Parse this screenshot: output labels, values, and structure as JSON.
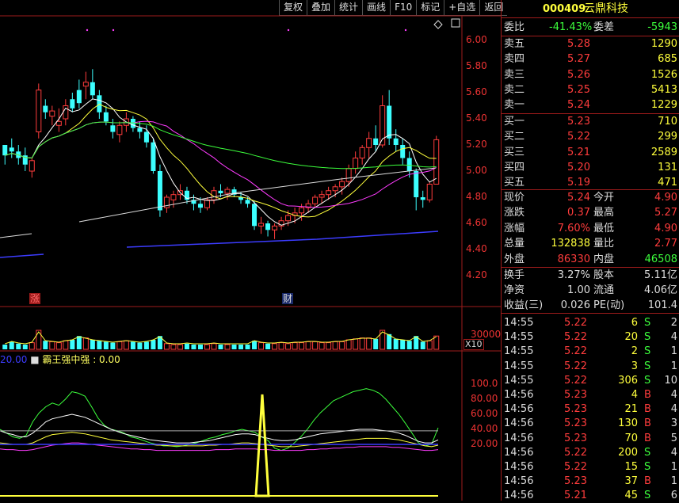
{
  "toolbar": {
    "items": [
      "复权",
      "叠加",
      "统计",
      "画线",
      "F10",
      "标记",
      "+自选",
      "返回"
    ]
  },
  "stock": {
    "code": "000409",
    "name": "云鼎科技"
  },
  "weibi": {
    "label1": "委比",
    "value1": "-41.43%",
    "label2": "委差",
    "value2": "-5943"
  },
  "asks": [
    {
      "label": "卖五",
      "price": "5.28",
      "vol": "1290"
    },
    {
      "label": "卖四",
      "price": "5.27",
      "vol": "685"
    },
    {
      "label": "卖三",
      "price": "5.26",
      "vol": "1526"
    },
    {
      "label": "卖二",
      "price": "5.25",
      "vol": "5413"
    },
    {
      "label": "卖一",
      "price": "5.24",
      "vol": "1229"
    }
  ],
  "bids": [
    {
      "label": "买一",
      "price": "5.23",
      "vol": "710"
    },
    {
      "label": "买二",
      "price": "5.22",
      "vol": "299"
    },
    {
      "label": "买三",
      "price": "5.21",
      "vol": "2589"
    },
    {
      "label": "买四",
      "price": "5.20",
      "vol": "131"
    },
    {
      "label": "买五",
      "price": "5.19",
      "vol": "471"
    }
  ],
  "quote": [
    {
      "l1": "现价",
      "v1": "5.24",
      "l2": "今开",
      "v2": "4.90",
      "c1": "red",
      "c2": "red"
    },
    {
      "l1": "涨跌",
      "v1": "0.37",
      "l2": "最高",
      "v2": "5.27",
      "c1": "red",
      "c2": "red"
    },
    {
      "l1": "涨幅",
      "v1": "7.60%",
      "l2": "最低",
      "v2": "4.90",
      "c1": "red",
      "c2": "red"
    },
    {
      "l1": "总量",
      "v1": "132838",
      "l2": "量比",
      "v2": "2.77",
      "c1": "yel",
      "c2": "red"
    },
    {
      "l1": "外盘",
      "v1": "86330",
      "l2": "内盘",
      "v2": "46508",
      "c1": "red",
      "c2": "grn"
    }
  ],
  "info": [
    {
      "l1": "换手",
      "v1": "3.27%",
      "l2": "股本",
      "v2": "5.11亿"
    },
    {
      "l1": "净资",
      "v1": "1.00",
      "l2": "流通",
      "v2": "4.06亿"
    },
    {
      "l1": "收益(三)",
      "v1": "0.026",
      "l2": "PE(动)",
      "v2": "101.4"
    }
  ],
  "ticks": [
    {
      "time": "14:55",
      "price": "5.22",
      "vol": "6",
      "bs": "S",
      "n": "2"
    },
    {
      "time": "14:55",
      "price": "5.22",
      "vol": "20",
      "bs": "S",
      "n": "4"
    },
    {
      "time": "14:55",
      "price": "5.22",
      "vol": "2",
      "bs": "S",
      "n": "1"
    },
    {
      "time": "14:55",
      "price": "5.22",
      "vol": "3",
      "bs": "S",
      "n": "1"
    },
    {
      "time": "14:55",
      "price": "5.22",
      "vol": "306",
      "bs": "S",
      "n": "10"
    },
    {
      "time": "14:56",
      "price": "5.23",
      "vol": "4",
      "bs": "B",
      "n": "4"
    },
    {
      "time": "14:56",
      "price": "5.23",
      "vol": "21",
      "bs": "B",
      "n": "4"
    },
    {
      "time": "14:56",
      "price": "5.23",
      "vol": "130",
      "bs": "B",
      "n": "3"
    },
    {
      "time": "14:56",
      "price": "5.23",
      "vol": "70",
      "bs": "B",
      "n": "5"
    },
    {
      "time": "14:56",
      "price": "5.22",
      "vol": "200",
      "bs": "S",
      "n": "4"
    },
    {
      "time": "14:56",
      "price": "5.22",
      "vol": "15",
      "bs": "S",
      "n": "1"
    },
    {
      "time": "14:56",
      "price": "5.23",
      "vol": "37",
      "bs": "B",
      "n": "1"
    },
    {
      "time": "14:56",
      "price": "5.21",
      "vol": "45",
      "bs": "S",
      "n": "6"
    }
  ],
  "price_axis": [
    "6.00",
    "5.80",
    "5.60",
    "5.40",
    "5.20",
    "5.00",
    "4.80",
    "4.60",
    "4.40",
    "4.20"
  ],
  "vol_axis": {
    "top": "30000",
    "unit": "X10"
  },
  "ind_axis": [
    "100.0",
    "80.00",
    "60.00",
    "40.00",
    "20.00"
  ],
  "markers": {
    "zhang": "涨",
    "cai": "财"
  },
  "indicator": {
    "prefix": "20.00",
    "name": "霸王强中强",
    "value": "0.00"
  },
  "colors": {
    "up": "#ff3c3c",
    "down": "#3cffff",
    "axis": "#9e1b1b"
  },
  "candles": [
    [
      5.2,
      5.2,
      5.05,
      5.12
    ],
    [
      5.18,
      5.25,
      5.1,
      5.15
    ],
    [
      5.15,
      5.2,
      5.05,
      5.1
    ],
    [
      5.12,
      5.18,
      5.0,
      5.05
    ],
    [
      5.0,
      5.1,
      4.95,
      5.08
    ],
    [
      5.3,
      5.67,
      5.25,
      5.62
    ],
    [
      5.5,
      5.55,
      5.4,
      5.45
    ],
    [
      5.42,
      5.5,
      5.35,
      5.46
    ],
    [
      5.35,
      5.48,
      5.3,
      5.38
    ],
    [
      5.4,
      5.55,
      5.35,
      5.5
    ],
    [
      5.55,
      5.6,
      5.45,
      5.48
    ],
    [
      5.62,
      5.7,
      5.48,
      5.52
    ],
    [
      5.65,
      5.76,
      5.55,
      5.68
    ],
    [
      5.68,
      5.78,
      5.55,
      5.58
    ],
    [
      5.58,
      5.62,
      5.4,
      5.45
    ],
    [
      5.45,
      5.5,
      5.35,
      5.38
    ],
    [
      5.35,
      5.4,
      5.25,
      5.3
    ],
    [
      5.28,
      5.38,
      5.22,
      5.35
    ],
    [
      5.35,
      5.45,
      5.3,
      5.4
    ],
    [
      5.4,
      5.42,
      5.3,
      5.33
    ],
    [
      5.33,
      5.38,
      5.25,
      5.3
    ],
    [
      5.3,
      5.35,
      5.18,
      5.22
    ],
    [
      5.22,
      5.25,
      4.98,
      5.0
    ],
    [
      5.0,
      5.05,
      4.65,
      4.7
    ],
    [
      4.72,
      4.82,
      4.68,
      4.8
    ],
    [
      4.78,
      4.85,
      4.72,
      4.82
    ],
    [
      4.82,
      4.9,
      4.78,
      4.85
    ],
    [
      4.85,
      4.88,
      4.75,
      4.78
    ],
    [
      4.78,
      4.82,
      4.7,
      4.75
    ],
    [
      4.75,
      4.8,
      4.68,
      4.72
    ],
    [
      4.72,
      4.8,
      4.7,
      4.78
    ],
    [
      4.78,
      4.88,
      4.75,
      4.85
    ],
    [
      4.85,
      4.9,
      4.8,
      4.83
    ],
    [
      4.83,
      4.88,
      4.78,
      4.86
    ],
    [
      4.86,
      4.88,
      4.8,
      4.82
    ],
    [
      4.8,
      4.84,
      4.75,
      4.78
    ],
    [
      4.78,
      4.8,
      4.72,
      4.75
    ],
    [
      4.75,
      4.77,
      4.55,
      4.58
    ],
    [
      4.58,
      4.65,
      4.52,
      4.6
    ],
    [
      4.6,
      4.62,
      4.5,
      4.55
    ],
    [
      4.55,
      4.6,
      4.48,
      4.58
    ],
    [
      4.58,
      4.65,
      4.55,
      4.62
    ],
    [
      4.62,
      4.7,
      4.58,
      4.66
    ],
    [
      4.66,
      4.72,
      4.6,
      4.68
    ],
    [
      4.68,
      4.75,
      4.62,
      4.72
    ],
    [
      4.72,
      4.78,
      4.68,
      4.75
    ],
    [
      4.75,
      4.82,
      4.72,
      4.8
    ],
    [
      4.8,
      4.85,
      4.75,
      4.82
    ],
    [
      4.82,
      4.88,
      4.78,
      4.85
    ],
    [
      4.85,
      4.9,
      4.8,
      4.88
    ],
    [
      4.88,
      4.95,
      4.82,
      4.92
    ],
    [
      4.92,
      5.05,
      4.88,
      5.02
    ],
    [
      5.02,
      5.15,
      4.98,
      5.1
    ],
    [
      5.1,
      5.2,
      5.05,
      5.18
    ],
    [
      5.18,
      5.3,
      5.1,
      5.25
    ],
    [
      5.25,
      5.35,
      5.15,
      5.2
    ],
    [
      5.2,
      5.58,
      5.18,
      5.5
    ],
    [
      5.5,
      5.62,
      5.2,
      5.25
    ],
    [
      5.25,
      5.32,
      5.15,
      5.2
    ],
    [
      5.2,
      5.25,
      5.05,
      5.1
    ],
    [
      5.1,
      5.15,
      4.95,
      5.0
    ],
    [
      5.0,
      5.02,
      4.7,
      4.8
    ],
    [
      4.8,
      4.85,
      4.72,
      4.78
    ],
    [
      4.78,
      4.92,
      4.76,
      4.9
    ],
    [
      4.9,
      5.27,
      4.9,
      5.24
    ]
  ],
  "volumes": [
    5,
    8,
    6,
    5,
    7,
    20,
    9,
    8,
    7,
    9,
    10,
    14,
    12,
    10,
    9,
    8,
    7,
    8,
    9,
    8,
    7,
    8,
    10,
    14,
    6,
    5,
    5,
    6,
    5,
    5,
    5,
    6,
    5,
    5,
    5,
    5,
    5,
    9,
    7,
    6,
    6,
    7,
    6,
    7,
    7,
    8,
    8,
    7,
    7,
    8,
    8,
    10,
    11,
    12,
    12,
    11,
    20,
    16,
    11,
    10,
    9,
    14,
    8,
    9,
    14
  ],
  "ind_lines": {
    "green": [
      40,
      35,
      30,
      28,
      32,
      50,
      62,
      70,
      75,
      72,
      80,
      90,
      88,
      84,
      70,
      55,
      45,
      40,
      38,
      35,
      30,
      28,
      25,
      22,
      20,
      18,
      18,
      17,
      18,
      20,
      22,
      25,
      28,
      30,
      33,
      35,
      38,
      40,
      38,
      36,
      30,
      25,
      15,
      12,
      15,
      22,
      30,
      40,
      52,
      62,
      70,
      78,
      82,
      86,
      90,
      92,
      94,
      92,
      88,
      80,
      70,
      60,
      48,
      35,
      22,
      18,
      20,
      42
    ],
    "white": [
      38,
      35,
      33,
      30,
      30,
      35,
      42,
      50,
      54,
      56,
      58,
      60,
      58,
      56,
      52,
      48,
      44,
      40,
      37,
      34,
      32,
      30,
      28,
      26,
      25,
      24,
      23,
      22,
      22,
      22,
      23,
      24,
      25,
      27,
      29,
      31,
      33,
      34,
      34,
      33,
      30,
      28,
      26,
      25,
      25,
      26,
      28,
      30,
      32,
      34,
      35,
      36,
      37,
      38,
      39,
      40,
      40,
      40,
      39,
      38,
      37,
      35,
      32,
      28,
      24,
      22,
      22,
      26
    ],
    "yellow": [
      22,
      21,
      20,
      20,
      20,
      22,
      26,
      30,
      33,
      34,
      35,
      36,
      35,
      34,
      32,
      30,
      28,
      26,
      25,
      24,
      23,
      22,
      21,
      20,
      19,
      19,
      18,
      18,
      18,
      18,
      18,
      18,
      19,
      19,
      20,
      20,
      21,
      22,
      22,
      21,
      20,
      19,
      18,
      17,
      17,
      17,
      18,
      19,
      20,
      21,
      22,
      23,
      24,
      25,
      26,
      27,
      28,
      28,
      28,
      28,
      27,
      26,
      24,
      22,
      20,
      18,
      17,
      19
    ],
    "magenta": [
      14,
      13,
      13,
      12,
      12,
      13,
      15,
      17,
      19,
      20,
      21,
      22,
      22,
      21,
      20,
      19,
      18,
      17,
      16,
      15,
      14,
      14,
      13,
      13,
      12,
      12,
      12,
      12,
      12,
      12,
      12,
      12,
      12,
      13,
      13,
      13,
      14,
      14,
      14,
      14,
      13,
      13,
      12,
      12,
      12,
      12,
      12,
      13,
      13,
      14,
      14,
      15,
      15,
      16,
      16,
      17,
      17,
      17,
      17,
      17,
      16,
      16,
      15,
      14,
      13,
      12,
      12,
      13
    ]
  }
}
